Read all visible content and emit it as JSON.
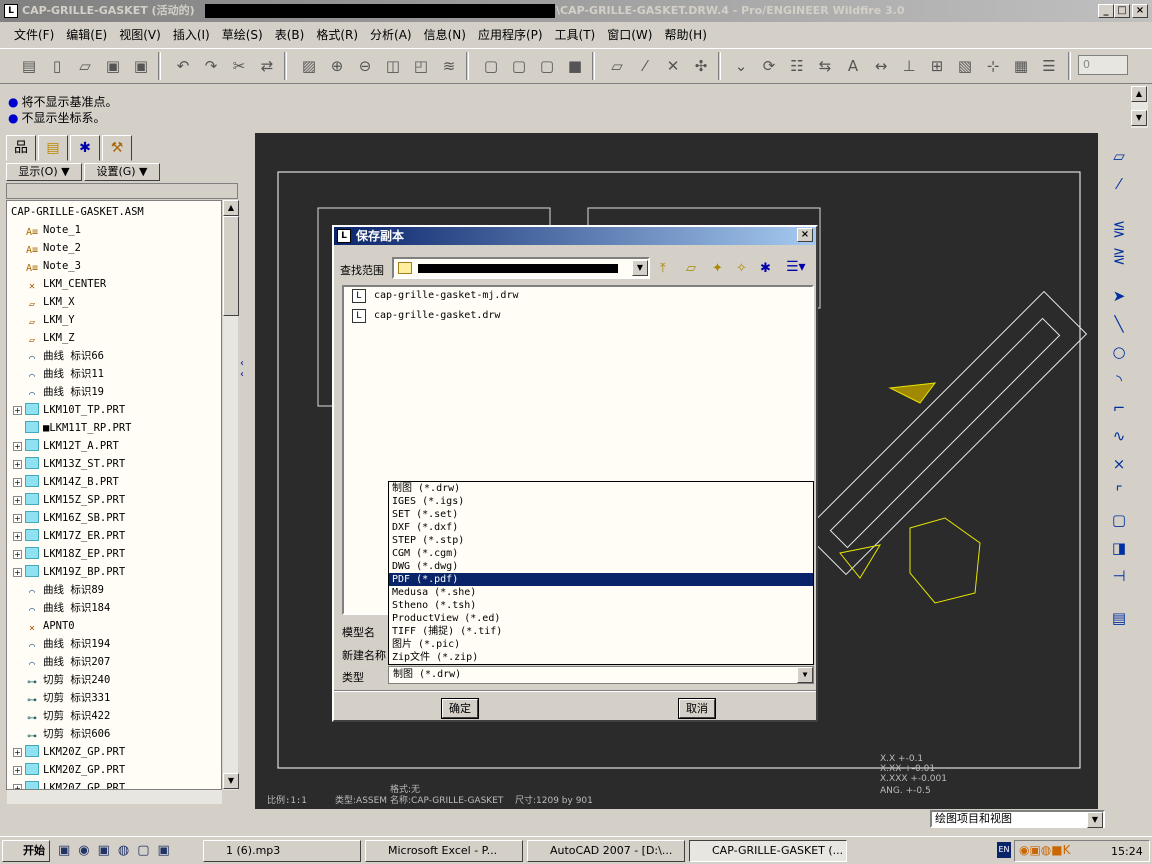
{
  "title": {
    "app_prefix": "CAP-GRILLE-GASKET (活动的)",
    "app_suffix": "\\CAP-GRILLE-GASKET.DRW.4 - Pro/ENGINEER Wildfire 3.0",
    "controls": [
      "_",
      "□",
      "×"
    ]
  },
  "menu": [
    "文件(F)",
    "编辑(E)",
    "视图(V)",
    "插入(I)",
    "草绘(S)",
    "表(B)",
    "格式(R)",
    "分析(A)",
    "信息(N)",
    "应用程序(P)",
    "工具(T)",
    "窗口(W)",
    "帮助(H)"
  ],
  "toolbar": {
    "spinner_value": "0"
  },
  "messages": [
    "将不显示基准点。",
    "不显示坐标系。"
  ],
  "left_panel": {
    "show_button": "显示(O) ▼",
    "settings_button": "设置(G) ▼",
    "tree_root": "CAP-GRILLE-GASKET.ASM",
    "tree_items": [
      {
        "label": "Note_1",
        "type": "note"
      },
      {
        "label": "Note_2",
        "type": "note"
      },
      {
        "label": "Note_3",
        "type": "note"
      },
      {
        "label": "LKM_CENTER",
        "type": "csys"
      },
      {
        "label": "LKM_X",
        "type": "plane"
      },
      {
        "label": "LKM_Y",
        "type": "plane"
      },
      {
        "label": "LKM_Z",
        "type": "plane"
      },
      {
        "label": "曲线 标识66",
        "type": "curve"
      },
      {
        "label": "曲线 标识11",
        "type": "curve"
      },
      {
        "label": "曲线 标识19",
        "type": "curve"
      },
      {
        "label": "LKM10T_TP.PRT",
        "type": "part",
        "expandable": true
      },
      {
        "label": "■LKM11T_RP.PRT",
        "type": "part"
      },
      {
        "label": "LKM12T_A.PRT",
        "type": "part",
        "expandable": true
      },
      {
        "label": "LKM13Z_ST.PRT",
        "type": "part",
        "expandable": true
      },
      {
        "label": "LKM14Z_B.PRT",
        "type": "part",
        "expandable": true
      },
      {
        "label": "LKM15Z_SP.PRT",
        "type": "part",
        "expandable": true
      },
      {
        "label": "LKM16Z_SB.PRT",
        "type": "part",
        "expandable": true
      },
      {
        "label": "LKM17Z_ER.PRT",
        "type": "part",
        "expandable": true
      },
      {
        "label": "LKM18Z_EP.PRT",
        "type": "part",
        "expandable": true
      },
      {
        "label": "LKM19Z_BP.PRT",
        "type": "part",
        "expandable": true
      },
      {
        "label": "曲线 标识89",
        "type": "curve"
      },
      {
        "label": "曲线 标识184",
        "type": "curve"
      },
      {
        "label": "APNT0",
        "type": "point"
      },
      {
        "label": "曲线 标识194",
        "type": "curve"
      },
      {
        "label": "曲线 标识207",
        "type": "curve"
      },
      {
        "label": "切剪 标识240",
        "type": "cut"
      },
      {
        "label": "切剪 标识331",
        "type": "cut"
      },
      {
        "label": "切剪 标识422",
        "type": "cut"
      },
      {
        "label": "切剪 标识606",
        "type": "cut"
      },
      {
        "label": "LKM20Z_GP.PRT",
        "type": "part",
        "expandable": true
      },
      {
        "label": "LKM20Z_GP.PRT",
        "type": "part",
        "expandable": true
      },
      {
        "label": "LKM20Z_GP.PRT",
        "type": "part",
        "expandable": true
      }
    ]
  },
  "drawing": {
    "footer": [
      "比例:1:1",
      "类型:ASSEM",
      "名称:CAP-GRILLE-GASKET",
      "尺寸:1209 by 901"
    ],
    "sheet": "格式:无",
    "tolerances": [
      "X.X  +-0.1",
      "X.XX  +-0.01",
      "X.XXX +-0.001",
      "ANG.  +-0.5"
    ]
  },
  "status": {
    "filter_select": "绘图项目和视图"
  },
  "dialog": {
    "title": "保存副本",
    "lookin_label": "查找范围",
    "files": [
      "cap-grille-gasket-mj.drw",
      "cap-grille-gasket.drw"
    ],
    "model_name_label": "模型名",
    "new_name_label": "新建名称",
    "type_label": "类型",
    "type_options": [
      "制图 (*.drw)",
      "IGES (*.igs)",
      "SET (*.set)",
      "DXF (*.dxf)",
      "STEP (*.stp)",
      "CGM (*.cgm)",
      "DWG (*.dwg)",
      "PDF (*.pdf)",
      "Medusa (*.she)",
      "Stheno (*.tsh)",
      "ProductView (*.ed)",
      "TIFF (捕捉) (*.tif)",
      "图片 (*.pic)",
      "Zip文件 (*.zip)"
    ],
    "highlighted_option": "PDF (*.pdf)",
    "type_value": "制图 (*.drw)",
    "ok": "确定",
    "cancel": "取消"
  },
  "taskbar": {
    "start": "开始",
    "tasks": [
      "1 (6).mp3",
      "Microsoft Excel - P...",
      "AutoCAD 2007 - [D:\\...",
      "CAP-GRILLE-GASKET (..."
    ],
    "lang": "EN",
    "clock": "15:24"
  },
  "colors": {
    "graphics_bg": "#2b2b2b",
    "selection": "#0a246a",
    "geometry": "#e8e800",
    "title_active": "#0a246a"
  }
}
